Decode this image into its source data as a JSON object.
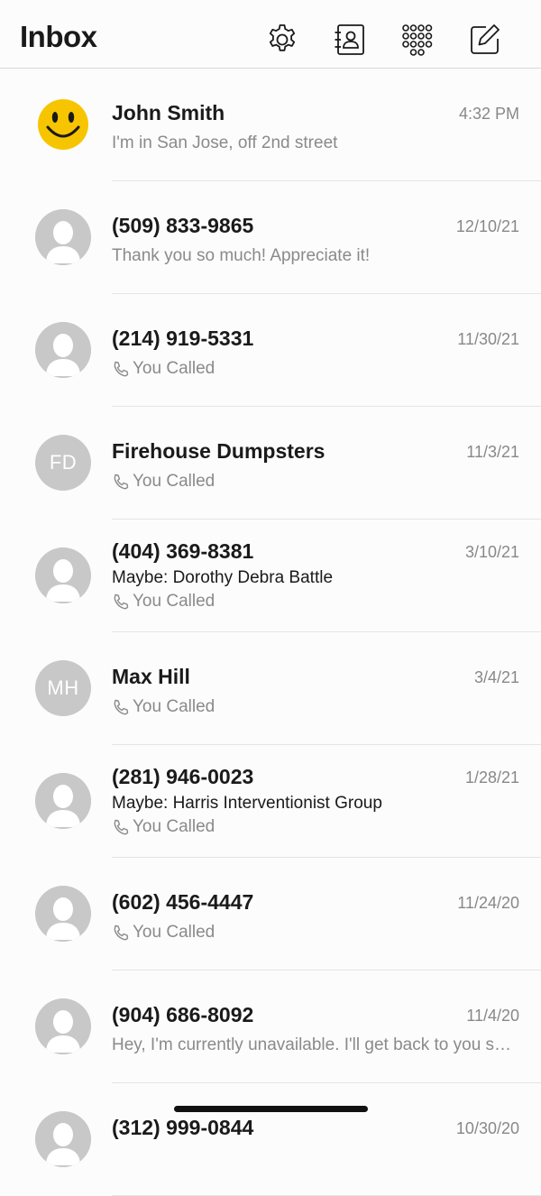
{
  "header": {
    "title": "Inbox",
    "icons": [
      "gear-icon",
      "contacts-icon",
      "dialpad-icon",
      "compose-icon"
    ]
  },
  "conversations": [
    {
      "name": "John  Smith",
      "date": "4:32 PM",
      "avatar": "smiley",
      "preview": "I'm in San Jose, off 2nd street"
    },
    {
      "name": "(509) 833-9865",
      "date": "12/10/21",
      "avatar": "person",
      "preview": "Thank you so much! Appreciate it!"
    },
    {
      "name": "(214) 919-5331",
      "date": "11/30/21",
      "avatar": "person",
      "called": "You Called"
    },
    {
      "name": "Firehouse Dumpsters",
      "date": "11/3/21",
      "avatar": "initials",
      "initials": "FD",
      "called": "You Called"
    },
    {
      "name": "(404) 369-8381",
      "date": "3/10/21",
      "avatar": "person",
      "maybe": "Maybe: Dorothy Debra Battle",
      "called": "You Called"
    },
    {
      "name": "Max Hill",
      "date": "3/4/21",
      "avatar": "initials",
      "initials": "MH",
      "called": "You Called"
    },
    {
      "name": "(281) 946-0023",
      "date": "1/28/21",
      "avatar": "person",
      "maybe": "Maybe: Harris Interventionist Group",
      "called": "You Called"
    },
    {
      "name": "(602) 456-4447",
      "date": "11/24/20",
      "avatar": "person",
      "called": "You Called"
    },
    {
      "name": "(904) 686-8092",
      "date": "11/4/20",
      "avatar": "person",
      "preview": "Hey, I'm currently unavailable. I'll get back to you shortly."
    },
    {
      "name": "(312) 999-0844",
      "date": "10/30/20",
      "avatar": "person"
    }
  ]
}
